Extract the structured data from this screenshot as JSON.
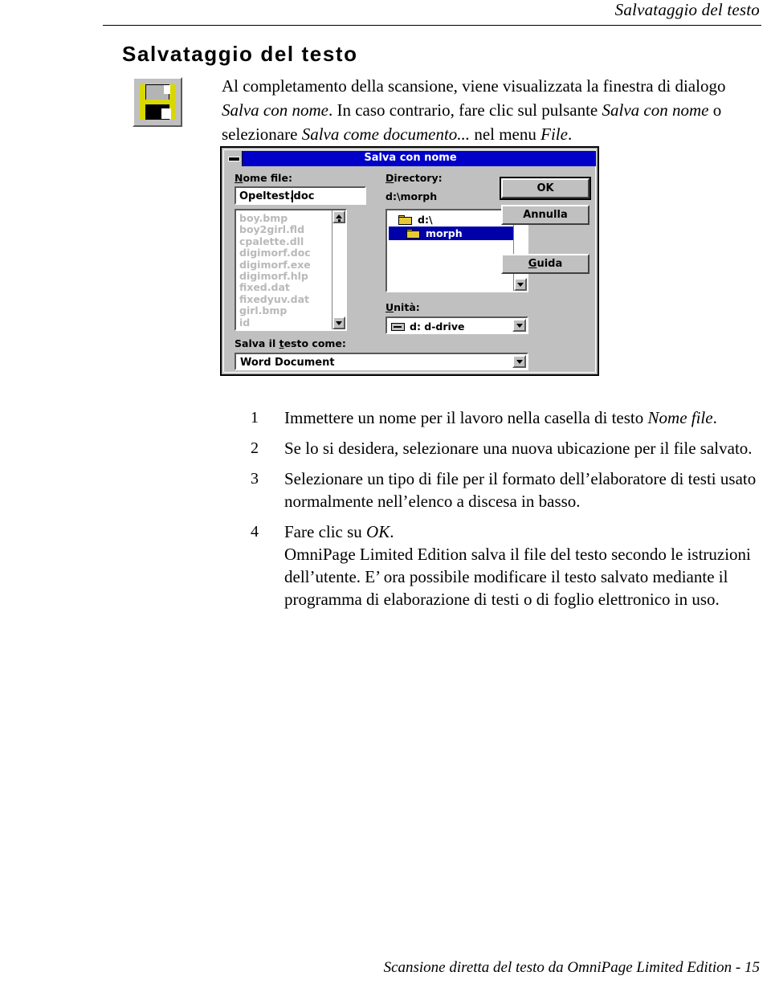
{
  "header": {
    "running_title": "Salvataggio del testo"
  },
  "title": "Salvataggio del testo",
  "intro": {
    "part1": "Al completamento della scansione, viene visualizzata la finestra di dialogo ",
    "em1": "Salva con nome",
    "part2": ". In caso contrario, fare clic sul pulsante ",
    "em2": "Salva con nome",
    "part3": " o selezionare ",
    "em3": "Salva come documento...",
    "part4": " nel menu ",
    "em4": "File",
    "part5": "."
  },
  "dialog": {
    "title": "Salva con nome",
    "sysmenu_icon": "system-menu-icon",
    "filename_label_pre": "N",
    "filename_label_accel": "N",
    "filename_label": "Nome file:",
    "filename_value": "Opeltest.doc",
    "directory_label": "Directory:",
    "directory_path": "d:\\morph",
    "drive_label": "Unità:",
    "drive_value": "d:  d-drive",
    "save_as_label": "Salva il testo come:",
    "format_value": "Word Document",
    "file_list": [
      "boy.bmp",
      "boy2girl.fld",
      "cpalette.dll",
      "digimorf.doc",
      "digimorf.exe",
      "digimorf.hlp",
      "fixed.dat",
      "fixedyuv.dat",
      "girl.bmp",
      "id"
    ],
    "directory_tree": [
      {
        "label": "d:\\",
        "selected": false
      },
      {
        "label": "morph",
        "selected": true
      }
    ],
    "buttons": {
      "ok": "OK",
      "cancel": "Annulla",
      "help": "Guida"
    },
    "colors": {
      "titlebar": "#0000c8",
      "face": "#c0c0c0",
      "selection": "#0000a8",
      "disabled_text": "#b9b9b9",
      "folder": "#e8c838"
    }
  },
  "steps": [
    {
      "num": "1",
      "text_pre": "Immettere un nome per il lavoro nella casella di testo ",
      "em": "Nome file",
      "text_post": "."
    },
    {
      "num": "2",
      "text_pre": "Se lo si desidera, selezionare una nuova ubicazione per il file salvato.",
      "em": "",
      "text_post": ""
    },
    {
      "num": "3",
      "text_pre": "Selezionare un tipo di file per il formato dell’elaboratore di testi usato normalmente nell’elenco a discesa in basso.",
      "em": "",
      "text_post": ""
    },
    {
      "num": "4",
      "text_pre": "Fare clic su ",
      "em": "OK",
      "text_post": ".",
      "continuation": "OmniPage Limited Edition salva il file del testo secondo le istruzioni dell’utente. E’ ora possibile modificare il testo salvato mediante il programma di elaborazione di testi o di foglio elettronico in uso."
    }
  ],
  "footer": "Scansione diretta del testo da OmniPage Limited Edition - 15"
}
